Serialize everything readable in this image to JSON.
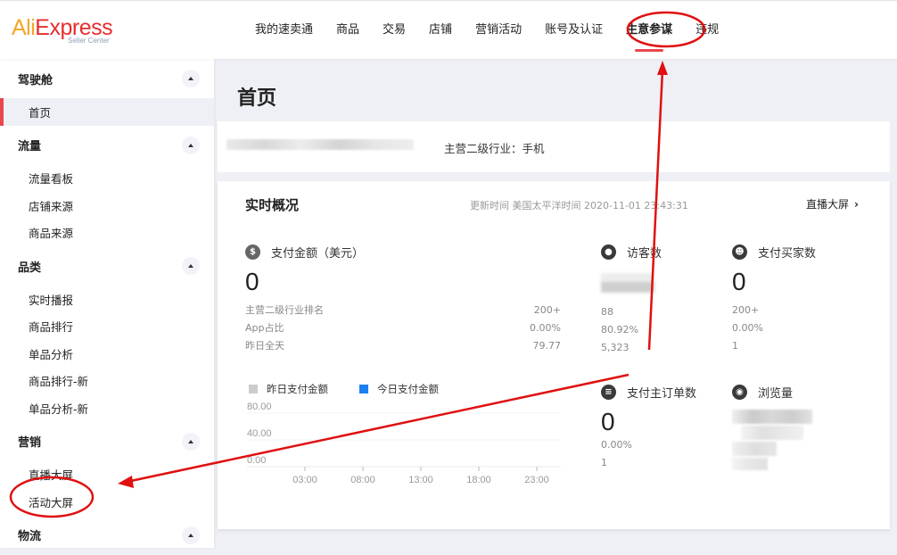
{
  "header": {
    "logo": {
      "ali": "Ali",
      "express": "Express",
      "sub": "Seller Center"
    },
    "nav": [
      {
        "label": "我的速卖通",
        "active": false
      },
      {
        "label": "商品",
        "active": false
      },
      {
        "label": "交易",
        "active": false
      },
      {
        "label": "店铺",
        "active": false
      },
      {
        "label": "营销活动",
        "active": false
      },
      {
        "label": "账号及认证",
        "active": false
      },
      {
        "label": "生意参谋",
        "active": true
      },
      {
        "label": "违规",
        "active": false
      }
    ]
  },
  "sidebar": {
    "groups": [
      {
        "label": "驾驶舱",
        "items": [
          "首页"
        ]
      },
      {
        "label": "流量",
        "items": [
          "流量看板",
          "店铺来源",
          "商品来源"
        ]
      },
      {
        "label": "品类",
        "items": [
          "实时播报",
          "商品排行",
          "单品分析",
          "商品排行-新",
          "单品分析-新"
        ]
      },
      {
        "label": "营销",
        "items": [
          "直播大屏",
          "活动大屏"
        ]
      },
      {
        "label": "物流",
        "items": []
      }
    ],
    "active_item": "首页"
  },
  "main": {
    "page_title": "首页",
    "industry": "主营二级行业：手机",
    "realtime": {
      "title": "实时概况",
      "update_time": "更新时间 美国太平洋时间 2020-11-01 23:43:31",
      "link": "直播大屏",
      "metrics": {
        "payment": {
          "icon": "dollar-icon",
          "label": "支付金额（美元）",
          "value": "0",
          "rows": [
            {
              "label": "主营二级行业排名",
              "value": "200+"
            },
            {
              "label": "App占比",
              "value": "0.00%"
            },
            {
              "label": "昨日全天",
              "value": "79.77"
            }
          ]
        },
        "visitors": {
          "icon": "paw-icon",
          "label": "访客数",
          "rows": [
            "88",
            "80.92%",
            "5,323"
          ]
        },
        "buyers": {
          "icon": "users-icon",
          "label": "支付买家数",
          "value": "0",
          "rows": [
            "200+",
            "0.00%",
            "1"
          ]
        },
        "orders": {
          "icon": "order-icon",
          "label": "支付主订单数",
          "value": "0",
          "rows": [
            "0.00%",
            "1"
          ]
        },
        "pageviews": {
          "icon": "eye-icon",
          "label": "浏览量"
        }
      }
    }
  },
  "chart_data": {
    "type": "line",
    "title": "",
    "legend": [
      {
        "name": "昨日支付金额",
        "color": "#cccccc"
      },
      {
        "name": "今日支付金额",
        "color": "#1a7ff0"
      }
    ],
    "legend_position": "top-left",
    "x": [
      "03:00",
      "08:00",
      "13:00",
      "18:00",
      "23:00"
    ],
    "y_ticks": [
      "0.00",
      "40.00",
      "80.00"
    ],
    "ylim": [
      0,
      80
    ],
    "grid": true,
    "series": [
      {
        "name": "昨日支付金额",
        "values": []
      },
      {
        "name": "今日支付金额",
        "values": []
      }
    ]
  },
  "annotations": {
    "color": "#e01010",
    "circled": [
      "生意参谋",
      "活动大屏"
    ]
  }
}
